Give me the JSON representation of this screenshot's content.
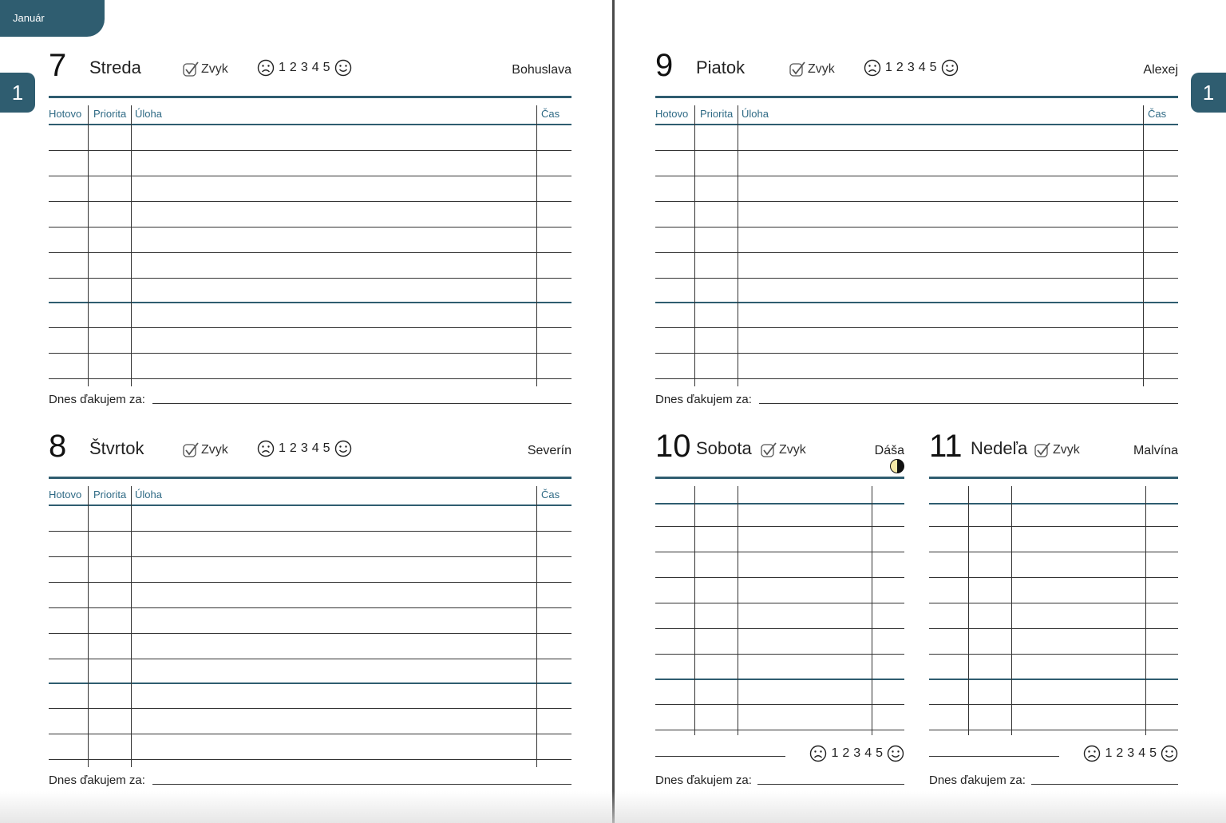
{
  "month_tab": "Január",
  "side_tab_left": "1",
  "side_tab_right": "1",
  "common": {
    "habit_label": "Zvyk",
    "mood_numbers": [
      "1",
      "2",
      "3",
      "4",
      "5"
    ],
    "col_done": "Hotovo",
    "col_priority": "Priorita",
    "col_task": "Úloha",
    "col_time": "Čas",
    "gratitude": "Dnes ďakujem za:"
  },
  "days": [
    {
      "num": "7",
      "name": "Streda",
      "nameday": "Bohuslava"
    },
    {
      "num": "8",
      "name": "Štvrtok",
      "nameday": "Severín"
    },
    {
      "num": "9",
      "name": "Piatok",
      "nameday": "Alexej"
    },
    {
      "num": "10",
      "name": "Sobota",
      "nameday": "Dáša"
    },
    {
      "num": "11",
      "name": "Nedeľa",
      "nameday": "Malvína"
    }
  ],
  "colors": {
    "accent": "#2f5d70",
    "header_text": "#2f6a85"
  }
}
